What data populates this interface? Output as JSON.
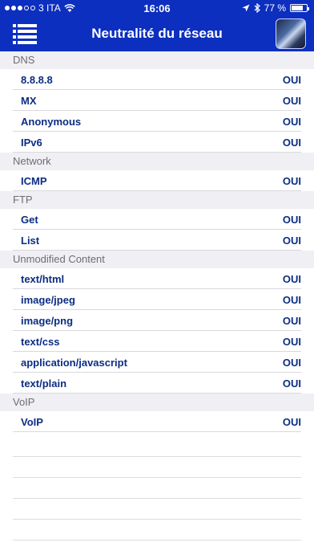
{
  "status_bar": {
    "carrier": "3 ITA",
    "time": "16:06",
    "battery_text": "77 %",
    "battery_level": 0.77
  },
  "nav": {
    "title": "Neutralité du réseau",
    "menu_icon": "list-menu-icon",
    "thumbnail": "app-thumbnail"
  },
  "colors": {
    "bar_blue": "#0c2fbf",
    "text_blue": "#0c2d83",
    "section_bg": "#efeff4"
  },
  "sections": [
    {
      "title": "DNS",
      "rows": [
        {
          "label": "8.8.8.8",
          "value": "OUI"
        },
        {
          "label": "MX",
          "value": "OUI"
        },
        {
          "label": "Anonymous",
          "value": "OUI"
        },
        {
          "label": "IPv6",
          "value": "OUI"
        }
      ]
    },
    {
      "title": "Network",
      "rows": [
        {
          "label": "ICMP",
          "value": "OUI"
        }
      ]
    },
    {
      "title": "FTP",
      "rows": [
        {
          "label": "Get",
          "value": "OUI"
        },
        {
          "label": "List",
          "value": "OUI"
        }
      ]
    },
    {
      "title": "Unmodified Content",
      "rows": [
        {
          "label": "text/html",
          "value": "OUI"
        },
        {
          "label": "image/jpeg",
          "value": "OUI"
        },
        {
          "label": "image/png",
          "value": "OUI"
        },
        {
          "label": "text/css",
          "value": "OUI"
        },
        {
          "label": "application/javascript",
          "value": "OUI"
        },
        {
          "label": "text/plain",
          "value": "OUI"
        }
      ]
    },
    {
      "title": "VoIP",
      "rows": [
        {
          "label": "VoIP",
          "value": "OUI"
        }
      ]
    }
  ]
}
